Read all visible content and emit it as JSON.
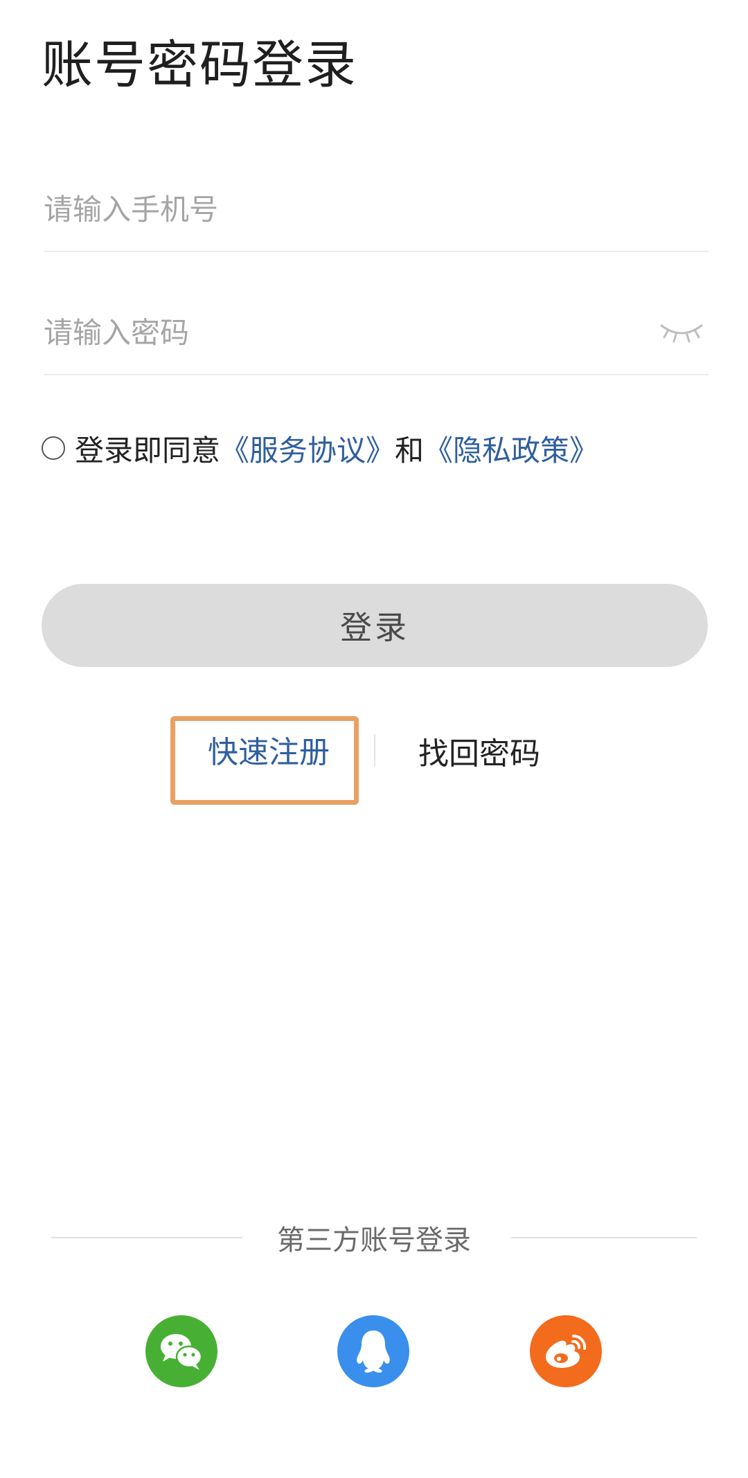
{
  "page": {
    "title": "账号密码登录"
  },
  "form": {
    "phone_placeholder": "请输入手机号",
    "password_placeholder": "请输入密码",
    "password_toggle_icon": "eye-closed-icon"
  },
  "agreement": {
    "checked": false,
    "prefix": "登录即同意",
    "service_link": "《服务协议》",
    "conjunction": "和",
    "privacy_link": "《隐私政策》"
  },
  "actions": {
    "login_label": "登录",
    "quick_register_label": "快速注册",
    "find_password_label": "找回密码"
  },
  "third_party": {
    "label": "第三方账号登录",
    "providers": [
      {
        "name": "wechat",
        "icon": "wechat-icon",
        "color": "#47b034"
      },
      {
        "name": "qq",
        "icon": "qq-penguin-icon",
        "color": "#3a8fec"
      },
      {
        "name": "weibo",
        "icon": "weibo-icon",
        "color": "#f36b1c"
      }
    ]
  },
  "colors": {
    "link_blue": "#2f5f9f",
    "highlight_orange": "#e8a063",
    "button_gray": "#dcdcdc"
  }
}
